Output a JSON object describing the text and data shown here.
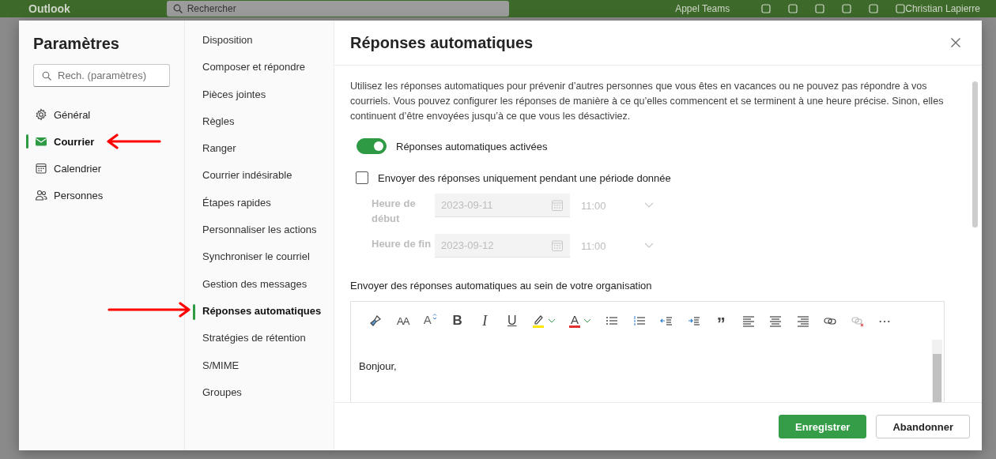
{
  "backdrop": {
    "app_name": "Outlook",
    "search_placeholder": "Rechercher",
    "teams_call": "Appel Teams",
    "user_name": "Christian Lapierre"
  },
  "dialog": {
    "title": "Paramètres",
    "search": {
      "placeholder": "Rech. (paramètres)"
    },
    "categories": [
      {
        "label": "Général",
        "selected": false,
        "marked": false
      },
      {
        "label": "Courrier",
        "selected": true,
        "marked": true
      },
      {
        "label": "Calendrier",
        "selected": false,
        "marked": false
      },
      {
        "label": "Personnes",
        "selected": false,
        "marked": false
      }
    ],
    "mail_settings": [
      {
        "label": "Disposition",
        "selected": false,
        "marked": false
      },
      {
        "label": "Composer et répondre",
        "selected": false,
        "marked": false
      },
      {
        "label": "Pièces jointes",
        "selected": false,
        "marked": false
      },
      {
        "label": "Règles",
        "selected": false,
        "marked": false
      },
      {
        "label": "Ranger",
        "selected": false,
        "marked": false
      },
      {
        "label": "Courrier indésirable",
        "selected": false,
        "marked": false
      },
      {
        "label": "Étapes rapides",
        "selected": false,
        "marked": false
      },
      {
        "label": "Personnaliser les actions",
        "selected": false,
        "marked": false
      },
      {
        "label": "Synchroniser le courriel",
        "selected": false,
        "marked": false
      },
      {
        "label": "Gestion des messages",
        "selected": false,
        "marked": false
      },
      {
        "label": "Réponses automatiques",
        "selected": true,
        "marked": true
      },
      {
        "label": "Stratégies de rétention",
        "selected": false,
        "marked": false
      },
      {
        "label": "S/MIME",
        "selected": false,
        "marked": false
      },
      {
        "label": "Groupes",
        "selected": false,
        "marked": false
      }
    ]
  },
  "pane": {
    "title": "Réponses automatiques",
    "description": "Utilisez les réponses automatiques pour prévenir d’autres personnes que vous êtes en vacances ou ne pouvez pas répondre à vos courriels. Vous pouvez configurer les réponses de manière à ce qu’elles commencent et se terminent à une heure précise. Sinon, elles continuent d’être envoyées jusqu’à ce que vous les désactiviez.",
    "toggle": {
      "label": "Réponses automatiques activées",
      "on": true
    },
    "period": {
      "label": "Envoyer des réponses uniquement pendant une période donnée",
      "checked": false
    },
    "times": [
      {
        "label": "Heure de début",
        "date": "2023-09-11",
        "time": "11:00",
        "disabled": true
      },
      {
        "label": "Heure de fin",
        "date": "2023-09-12",
        "time": "11:00",
        "disabled": true
      }
    ],
    "internal_label": "Envoyer des réponses automatiques au sein de votre organisation",
    "toolbar": [
      {
        "kind": "painter"
      },
      {
        "kind": "size",
        "label": "AA"
      },
      {
        "kind": "grow",
        "label": "A"
      },
      {
        "kind": "bold",
        "label": "B"
      },
      {
        "kind": "italic",
        "label": "I"
      },
      {
        "kind": "underline",
        "label": "U"
      },
      {
        "kind": "highlight",
        "color": "#ffe600"
      },
      {
        "kind": "fontcolor",
        "label": "A",
        "color": "#e03030"
      },
      {
        "kind": "bullets"
      },
      {
        "kind": "numbers"
      },
      {
        "kind": "outdent"
      },
      {
        "kind": "indent"
      },
      {
        "kind": "quote",
        "label": "”"
      },
      {
        "kind": "align-left"
      },
      {
        "kind": "align-center"
      },
      {
        "kind": "align-right"
      },
      {
        "kind": "link"
      },
      {
        "kind": "unlink"
      },
      {
        "kind": "more",
        "label": "⋯"
      }
    ],
    "message": "Bonjour,",
    "buttons": [
      {
        "label": "Enregistrer",
        "primary": true
      },
      {
        "label": "Abandonner",
        "primary": false
      }
    ]
  }
}
